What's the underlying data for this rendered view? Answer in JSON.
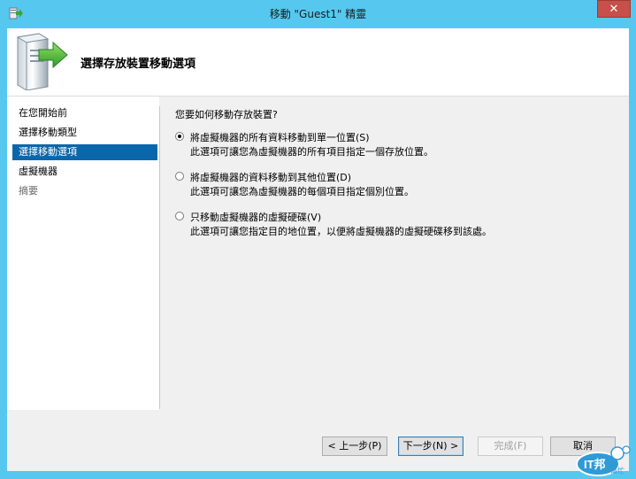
{
  "window": {
    "title": "移動 \"Guest1\" 精靈",
    "close_symbol": "✕",
    "titlebar_color": "#56c8f0",
    "close_color": "#c7504a"
  },
  "banner": {
    "title": "選擇存放裝置移動選項",
    "icon": "server-arrow-icon"
  },
  "nav": {
    "items": [
      {
        "label": "在您開始前",
        "state": "normal"
      },
      {
        "label": "選擇移動類型",
        "state": "normal"
      },
      {
        "label": "選擇移動選項",
        "state": "active"
      },
      {
        "label": "虛擬機器",
        "state": "normal"
      },
      {
        "label": "摘要",
        "state": "disabled"
      }
    ],
    "active_color": "#0b67ab"
  },
  "content": {
    "question": "您要如何移動存放裝置?",
    "options": [
      {
        "label": "將虛擬機器的所有資料移動到單一位置(S)",
        "description": "此選項可讓您為虛擬機器的所有項目指定一個存放位置。",
        "checked": true
      },
      {
        "label": "將虛擬機器的資料移動到其他位置(D)",
        "description": "此選項可讓您為虛擬機器的每個項目指定個別位置。",
        "checked": false
      },
      {
        "label": "只移動虛擬機器的虛擬硬碟(V)",
        "description": "此選項可讓您指定目的地位置，以便將虛擬機器的虛擬硬碟移到該處。",
        "checked": false
      }
    ]
  },
  "footer": {
    "prev": "< 上一步(P)",
    "next": "下一步(N) >",
    "finish": "完成(F)",
    "cancel": "取消"
  },
  "watermark": {
    "text_main": "IT邦",
    "text_sub": "幫忙"
  }
}
